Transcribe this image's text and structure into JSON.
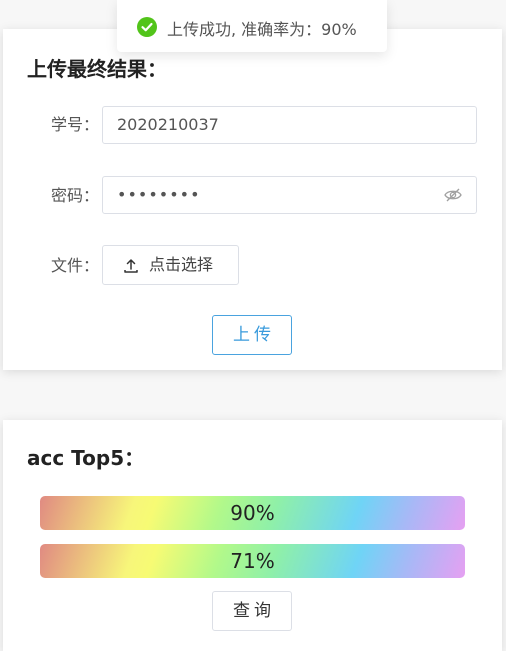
{
  "toast": {
    "message": "上传成功, 准确率为：90%",
    "icon": "success-check-icon",
    "color": "#52c41a"
  },
  "upload_card": {
    "title": "上传最终结果：",
    "student_id": {
      "label": "学号：",
      "value": "2020210037"
    },
    "password": {
      "label": "密码：",
      "value": "••••••••"
    },
    "file": {
      "label": "文件：",
      "button_label": "点击选择"
    },
    "submit_label": "上传"
  },
  "top_card": {
    "title": "acc Top5：",
    "results": [
      {
        "label": "90%",
        "value": 90
      },
      {
        "label": "71%",
        "value": 71
      }
    ],
    "query_label": "查询"
  },
  "colors": {
    "accent": "#3a9bdc",
    "success": "#52c41a"
  }
}
